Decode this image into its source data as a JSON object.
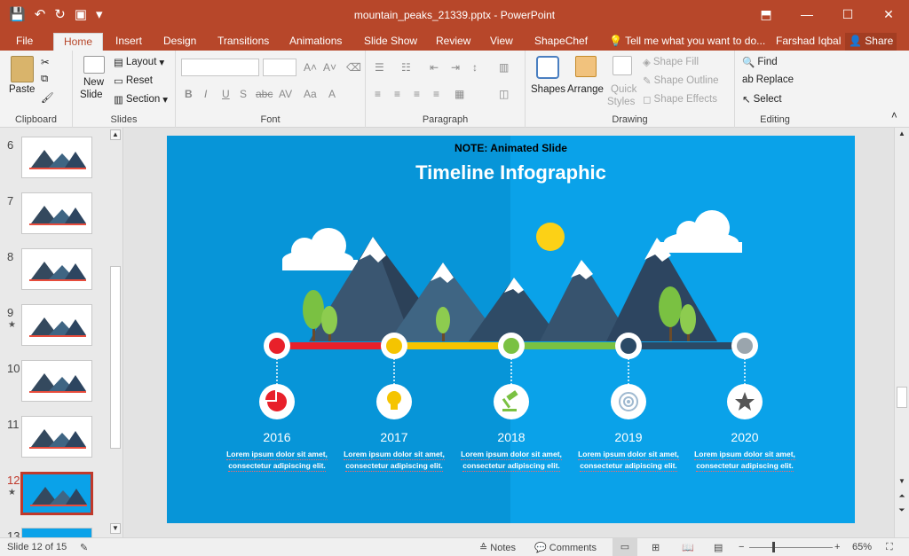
{
  "window": {
    "title": "mountain_peaks_21339.pptx - PowerPoint"
  },
  "tabs": [
    "File",
    "Home",
    "Insert",
    "Design",
    "Transitions",
    "Animations",
    "Slide Show",
    "Review",
    "View",
    "ShapeChef"
  ],
  "tell_me": "Tell me what you want to do...",
  "user": "Farshad Iqbal",
  "share": "Share",
  "ribbon": {
    "clipboard": {
      "paste": "Paste",
      "label": "Clipboard"
    },
    "slides": {
      "new_slide_1": "New",
      "new_slide_2": "Slide",
      "layout": "Layout",
      "reset": "Reset",
      "section": "Section",
      "label": "Slides"
    },
    "font": {
      "label": "Font"
    },
    "paragraph": {
      "label": "Paragraph"
    },
    "drawing": {
      "shapes": "Shapes",
      "arrange": "Arrange",
      "quick_1": "Quick",
      "quick_2": "Styles",
      "shape_fill": "Shape Fill",
      "shape_outline": "Shape Outline",
      "shape_effects": "Shape Effects",
      "label": "Drawing"
    },
    "editing": {
      "find": "Find",
      "replace": "Replace",
      "select": "Select",
      "label": "Editing"
    }
  },
  "thumbnails": [
    {
      "num": "6",
      "star": "",
      "active": false
    },
    {
      "num": "7",
      "star": "",
      "active": false
    },
    {
      "num": "8",
      "star": "",
      "active": false
    },
    {
      "num": "9",
      "star": "★",
      "active": false
    },
    {
      "num": "10",
      "star": "",
      "active": false
    },
    {
      "num": "11",
      "star": "",
      "active": false
    },
    {
      "num": "12",
      "star": "★",
      "active": true
    },
    {
      "num": "13",
      "star": "",
      "active": false
    }
  ],
  "slide": {
    "note": "NOTE: Animated Slide",
    "title": "Timeline Infographic",
    "colors": {
      "bg_left": "#0795d8",
      "bg_right": "#0aa2e9",
      "red": "#e8202a",
      "yellow": "#f5c400",
      "green": "#7ac142",
      "navy": "#2b4a66",
      "grey": "#9aa5ad"
    },
    "milestones": [
      {
        "year": "2016",
        "text1": "Lorem ipsum dolor sit amet,",
        "text2": "consectetur adipiscing elit.",
        "color": "#e8202a",
        "icon": "pie-chart-icon"
      },
      {
        "year": "2017",
        "text1": "Lorem ipsum dolor sit amet,",
        "text2": "consectetur adipiscing elit.",
        "color": "#f5c400",
        "icon": "lightbulb-icon"
      },
      {
        "year": "2018",
        "text1": "Lorem ipsum dolor sit amet,",
        "text2": "consectetur adipiscing elit.",
        "color": "#7ac142",
        "icon": "gavel-icon"
      },
      {
        "year": "2019",
        "text1": "Lorem ipsum dolor sit amet,",
        "text2": "consectetur adipiscing elit.",
        "color": "#2b4a66",
        "icon": "target-icon"
      },
      {
        "year": "2020",
        "text1": "Lorem ipsum dolor sit amet,",
        "text2": "consectetur adipiscing elit.",
        "color": "#9aa5ad",
        "icon": "star-icon"
      }
    ]
  },
  "status": {
    "slide": "Slide 12 of 15",
    "notes": "Notes",
    "comments": "Comments",
    "zoom": "65%"
  }
}
